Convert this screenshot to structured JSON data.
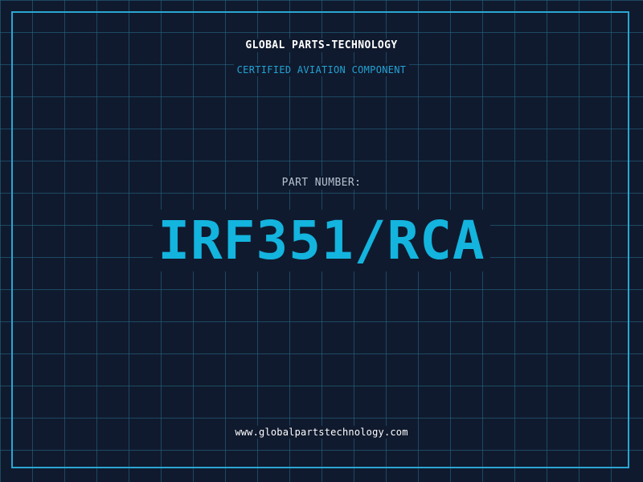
{
  "brand": {
    "name": "GLOBAL PARTS-TECHNOLOGY",
    "tagline": "CERTIFIED AVIATION COMPONENT"
  },
  "part": {
    "label": "PART NUMBER:",
    "number": "IRF351/RCA"
  },
  "footer": {
    "url": "www.globalpartstechnology.com"
  },
  "colors": {
    "background": "#101a2e",
    "grid": "#266e8c",
    "frame": "#2aa6d2",
    "accent": "#13b4de",
    "text": "#ffffff",
    "muted": "#b7c3d2"
  }
}
